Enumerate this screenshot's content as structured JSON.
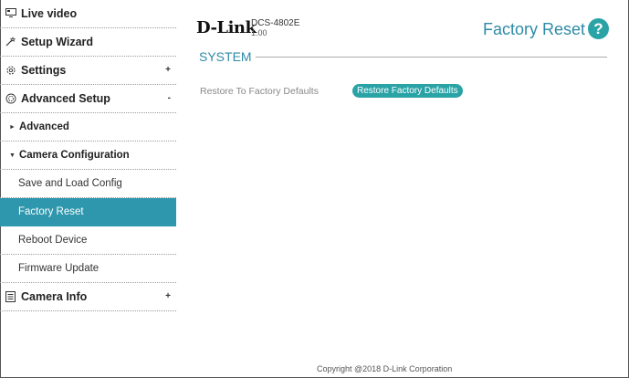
{
  "sidebar": {
    "live_video": "Live video",
    "setup_wizard": "Setup Wizard",
    "settings": "Settings",
    "advanced_setup": "Advanced Setup",
    "advanced": "Advanced",
    "camera_configuration": "Camera Configuration",
    "save_load_config": "Save and Load Config",
    "factory_reset": "Factory Reset",
    "reboot_device": "Reboot Device",
    "firmware_update": "Firmware Update",
    "camera_info": "Camera Info",
    "plus": "+",
    "minus": "-"
  },
  "header": {
    "logo": "D-Link",
    "model": "DCS-4802E",
    "version": "1.00",
    "page_title": "Factory Reset",
    "help": "?"
  },
  "section": {
    "title": "SYSTEM",
    "restore_label": "Restore To Factory Defaults",
    "restore_button": "Restore Factory Defaults"
  },
  "footer": {
    "copyright": "Copyright @2018 D-Link Corporation"
  },
  "colors": {
    "accent": "#2e97ad",
    "button": "#2aa3a6",
    "title": "#2e8aa6"
  },
  "icons": {
    "live_video": "monitor-icon",
    "setup_wizard": "wand-icon",
    "settings": "gear-icon",
    "advanced_setup": "advanced-gear-icon",
    "camera_info": "document-icon",
    "help": "help-icon"
  }
}
